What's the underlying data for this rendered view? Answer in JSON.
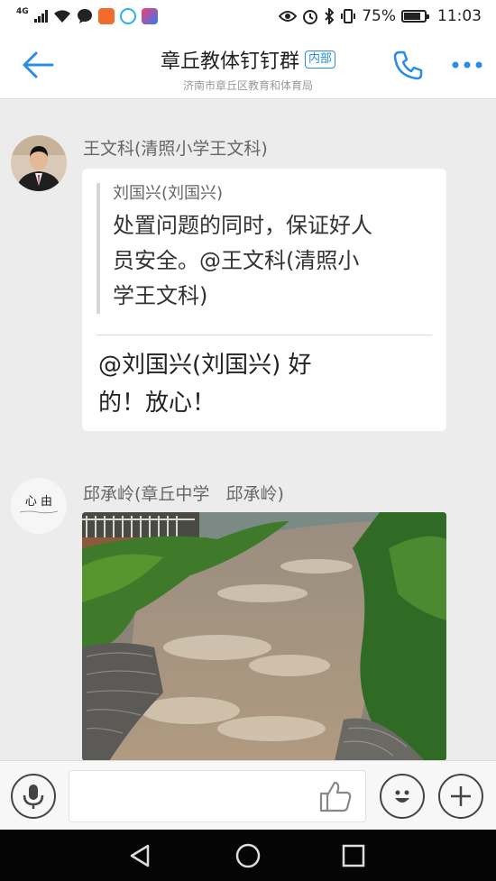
{
  "status_bar": {
    "network": "4G",
    "battery_percent": "75%",
    "time": "11:03"
  },
  "header": {
    "title": "章丘教体钉钉群",
    "badge": "内部",
    "subtitle": "济南市章丘区教育和体育局"
  },
  "messages": [
    {
      "sender": "王文科(清照小学王文科)",
      "quote_author": "刘国兴(刘国兴)",
      "quote_lines": [
        "处置问题的同时，保证好人",
        "员安全。@王文科(清照小",
        "学王文科)"
      ],
      "reply_lines": [
        "@刘国兴(刘国兴) 好",
        "的！放心！"
      ]
    },
    {
      "sender": "邱承岭(章丘中学   邱承岭)",
      "avatar_text": "心 由",
      "image": "flood-water-photo"
    }
  ],
  "input_bar": {
    "placeholder": ""
  },
  "colors": {
    "accent": "#2b8be8",
    "background": "#ececec"
  }
}
